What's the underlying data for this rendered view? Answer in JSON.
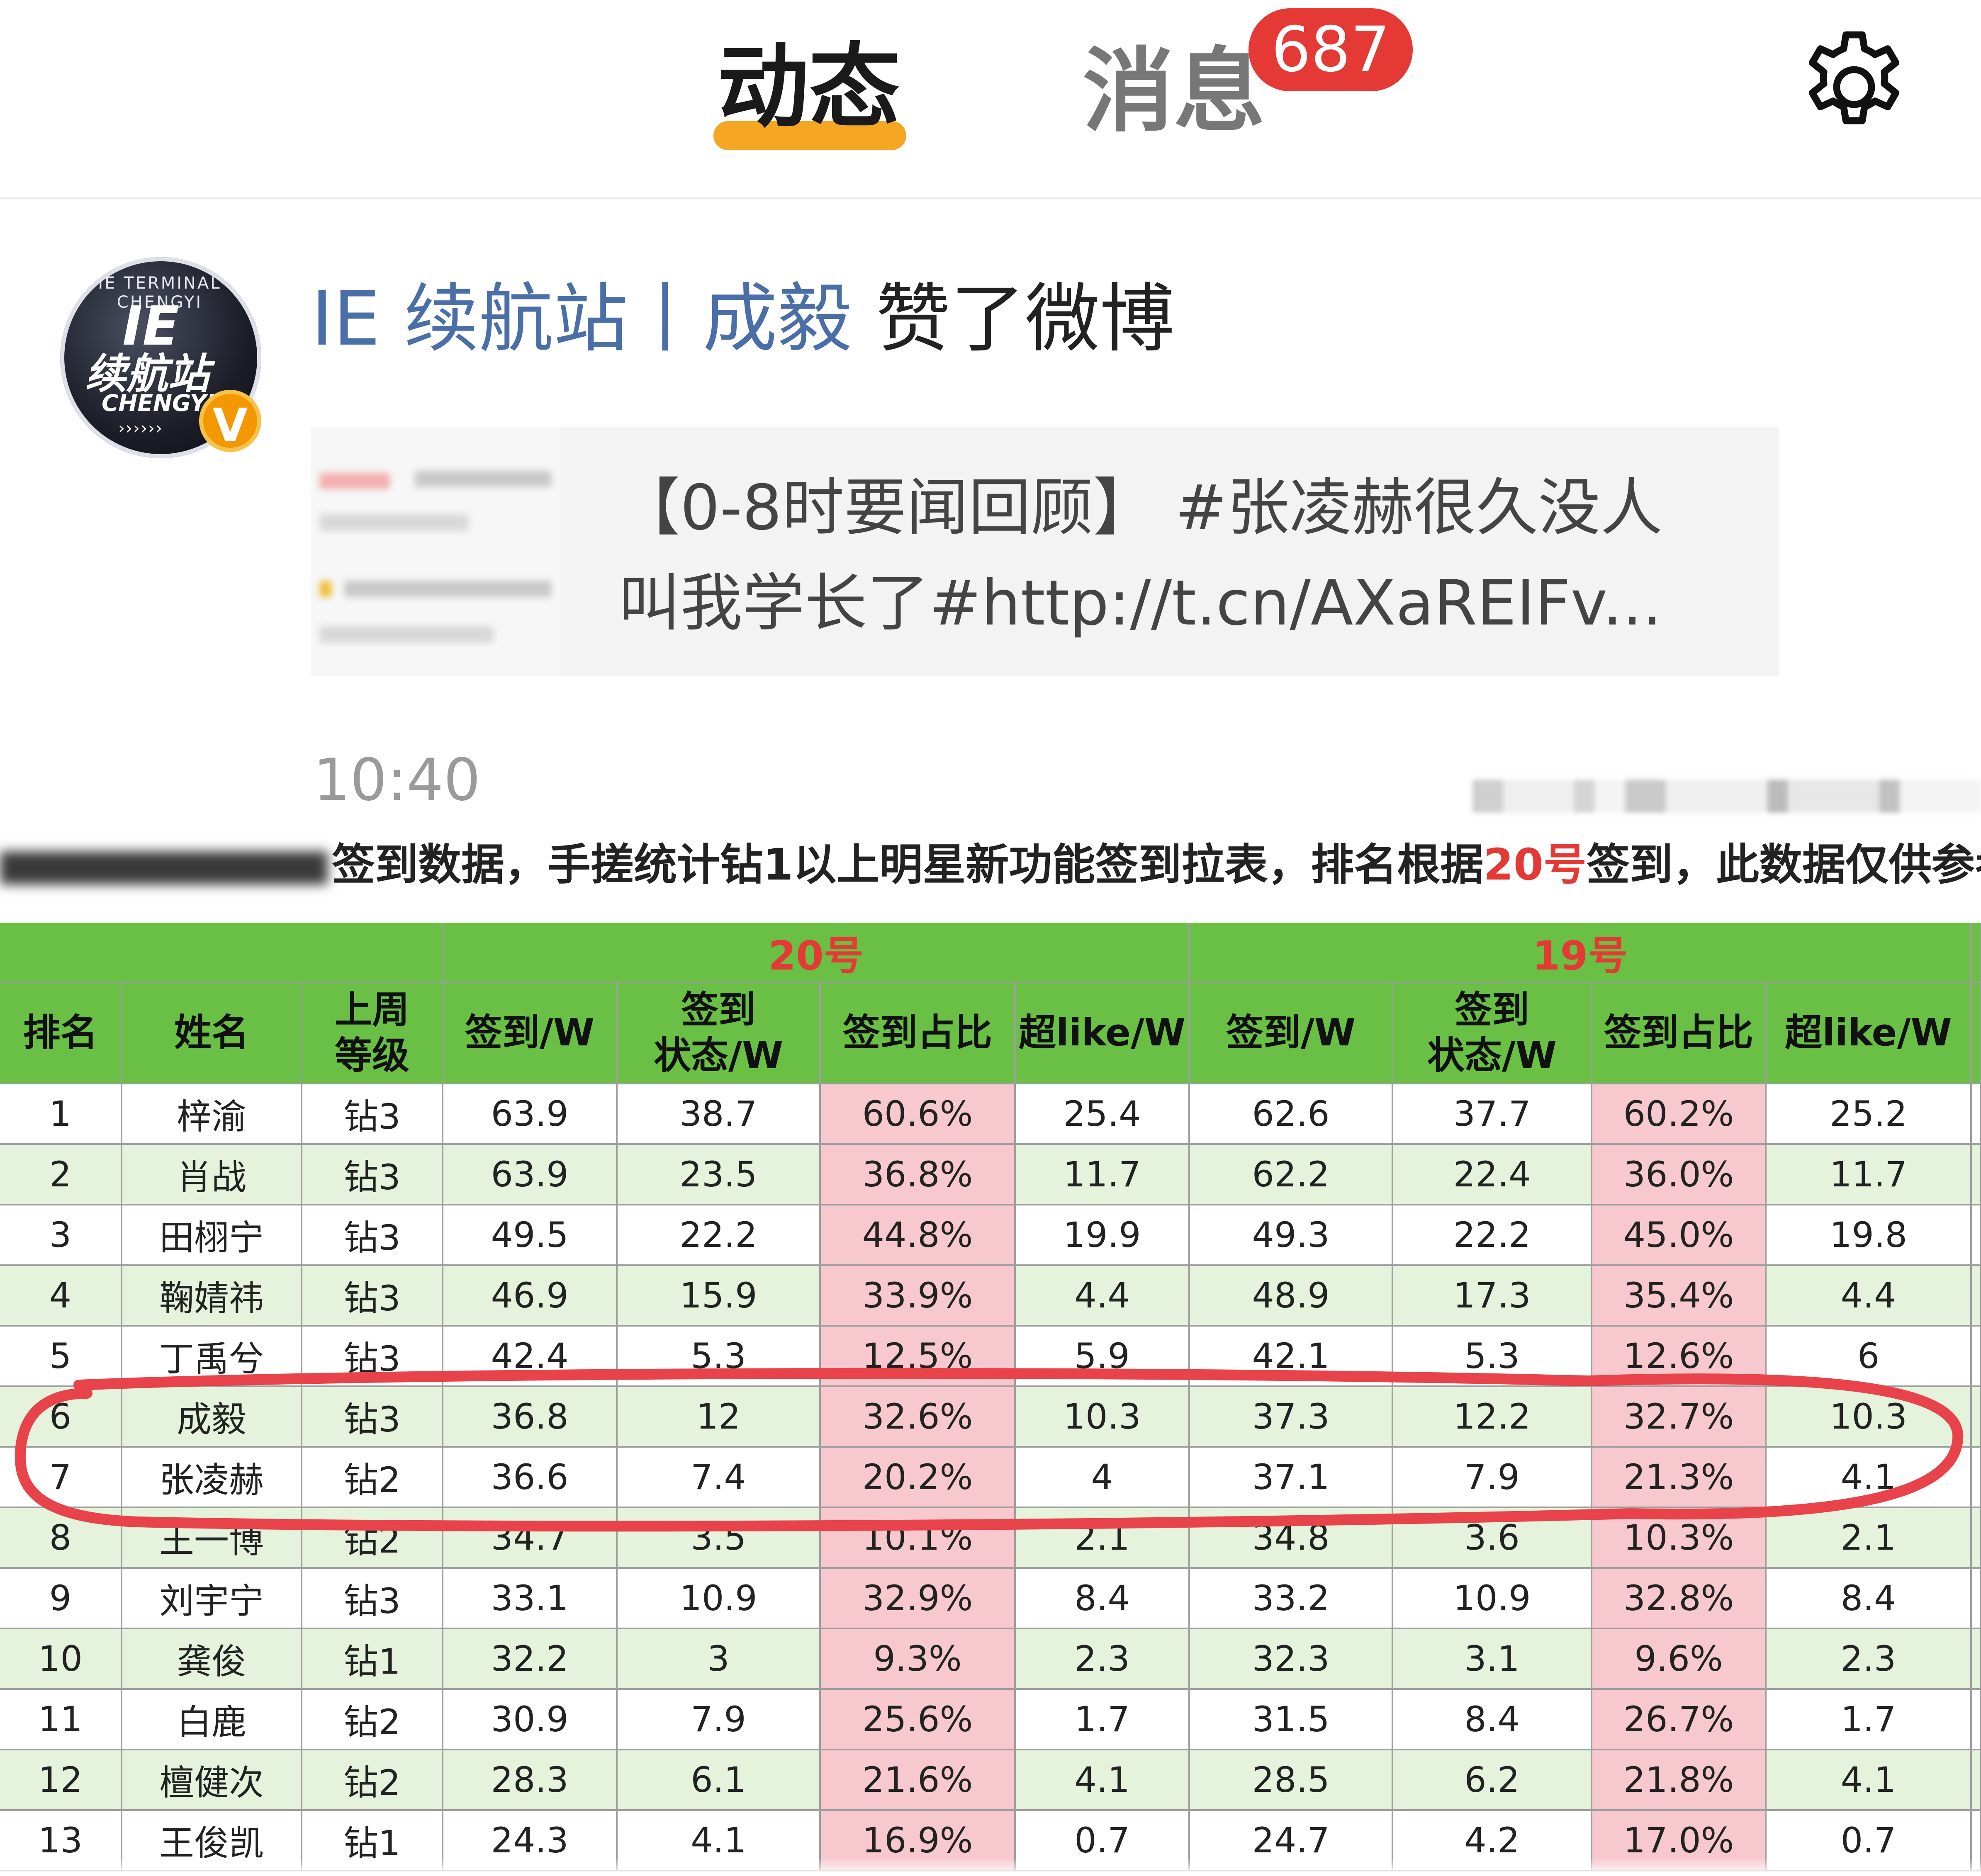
{
  "header": {
    "tabs": [
      {
        "label": "动态",
        "active": true
      },
      {
        "label": "消息",
        "active": false
      }
    ],
    "message_badge": "687",
    "settings_icon": "gear-icon",
    "colors": {
      "active_underline": "#f5a623",
      "badge": "#e53935"
    }
  },
  "feed": {
    "avatar": {
      "ring_text": "IE TERMINAL CHENGYI",
      "line1": "IE",
      "line2": "续航站",
      "line3": "CHENGYI",
      "line4": "››››››",
      "verified_badge": "V"
    },
    "title_who": "IE 续航站丨成毅",
    "title_action": " 赞了微博",
    "quote_text_line1": "【0-8时要闻回顾】 #张凌赫很久没人",
    "quote_text_line2": "叫我学长了#http://t.cn/AXaREIFv...",
    "time": "10:40"
  },
  "ranking": {
    "caption_mid": "签到数据，手搓统计钻1以上明星新功能签到拉表，排名根据",
    "caption_red": "20号",
    "caption_end": "签到，此数据仅供参考",
    "group_20": "20号",
    "group_19": "19号",
    "headers": {
      "rank": "排名",
      "name": "姓名",
      "level_l1": "上周",
      "level_l2": "等级",
      "checkin": "签到/W",
      "status_l1": "签到",
      "status_l2": "状态/W",
      "ratio": "签到占比",
      "superlike": "超like/W"
    },
    "rows": [
      {
        "rank": "1",
        "name": "梓渝",
        "level": "钻3",
        "d20": [
          "63.9",
          "38.7",
          "60.6%",
          "25.4"
        ],
        "d19": [
          "62.6",
          "37.7",
          "60.2%",
          "25.2"
        ]
      },
      {
        "rank": "2",
        "name": "肖战",
        "level": "钻3",
        "d20": [
          "63.9",
          "23.5",
          "36.8%",
          "11.7"
        ],
        "d19": [
          "62.2",
          "22.4",
          "36.0%",
          "11.7"
        ]
      },
      {
        "rank": "3",
        "name": "田栩宁",
        "level": "钻3",
        "d20": [
          "49.5",
          "22.2",
          "44.8%",
          "19.9"
        ],
        "d19": [
          "49.3",
          "22.2",
          "45.0%",
          "19.8"
        ]
      },
      {
        "rank": "4",
        "name": "鞠婧祎",
        "level": "钻3",
        "d20": [
          "46.9",
          "15.9",
          "33.9%",
          "4.4"
        ],
        "d19": [
          "48.9",
          "17.3",
          "35.4%",
          "4.4"
        ]
      },
      {
        "rank": "5",
        "name": "丁禹兮",
        "level": "钻3",
        "d20": [
          "42.4",
          "5.3",
          "12.5%",
          "5.9"
        ],
        "d19": [
          "42.1",
          "5.3",
          "12.6%",
          "6"
        ]
      },
      {
        "rank": "6",
        "name": "成毅",
        "level": "钻3",
        "d20": [
          "36.8",
          "12",
          "32.6%",
          "10.3"
        ],
        "d19": [
          "37.3",
          "12.2",
          "32.7%",
          "10.3"
        ]
      },
      {
        "rank": "7",
        "name": "张凌赫",
        "level": "钻2",
        "d20": [
          "36.6",
          "7.4",
          "20.2%",
          "4"
        ],
        "d19": [
          "37.1",
          "7.9",
          "21.3%",
          "4.1"
        ]
      },
      {
        "rank": "8",
        "name": "王一博",
        "level": "钻2",
        "d20": [
          "34.7",
          "3.5",
          "10.1%",
          "2.1"
        ],
        "d19": [
          "34.8",
          "3.6",
          "10.3%",
          "2.1"
        ]
      },
      {
        "rank": "9",
        "name": "刘宇宁",
        "level": "钻3",
        "d20": [
          "33.1",
          "10.9",
          "32.9%",
          "8.4"
        ],
        "d19": [
          "33.2",
          "10.9",
          "32.8%",
          "8.4"
        ]
      },
      {
        "rank": "10",
        "name": "龚俊",
        "level": "钻1",
        "d20": [
          "32.2",
          "3",
          "9.3%",
          "2.3"
        ],
        "d19": [
          "32.3",
          "3.1",
          "9.6%",
          "2.3"
        ]
      },
      {
        "rank": "11",
        "name": "白鹿",
        "level": "钻2",
        "d20": [
          "30.9",
          "7.9",
          "25.6%",
          "1.7"
        ],
        "d19": [
          "31.5",
          "8.4",
          "26.7%",
          "1.7"
        ]
      },
      {
        "rank": "12",
        "name": "檀健次",
        "level": "钻2",
        "d20": [
          "28.3",
          "6.1",
          "21.6%",
          "4.1"
        ],
        "d19": [
          "28.5",
          "6.2",
          "21.8%",
          "4.1"
        ]
      },
      {
        "rank": "13",
        "name": "王俊凯",
        "level": "钻1",
        "d20": [
          "24.3",
          "4.1",
          "16.9%",
          "0.7"
        ],
        "d19": [
          "24.7",
          "4.2",
          "17.0%",
          "0.7"
        ]
      }
    ],
    "colors": {
      "header_green": "#6abf45",
      "row_green": "#e5f2dc",
      "ratio_pink": "#f7c8cd",
      "highlight_red": "#e8434a"
    }
  }
}
